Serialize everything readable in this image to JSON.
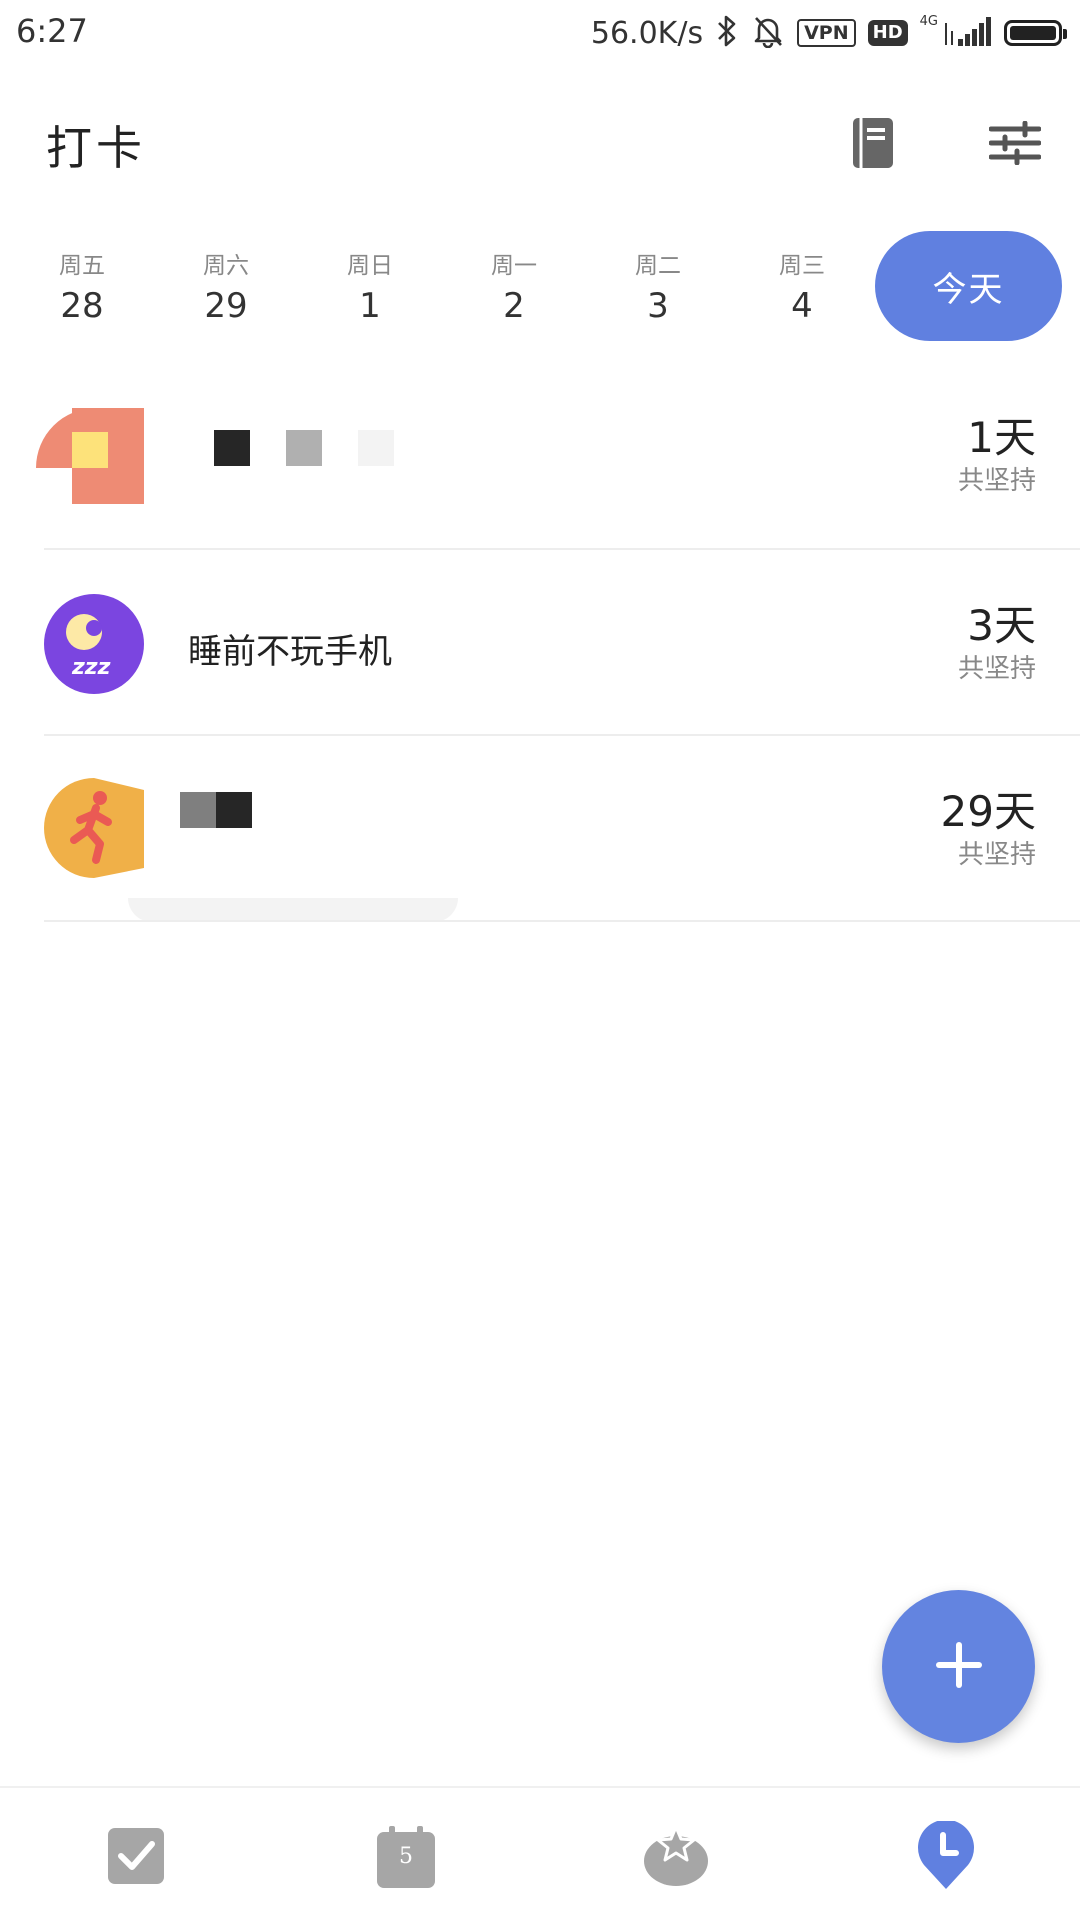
{
  "status_bar": {
    "time": "6:27",
    "net_speed": "56.0K/s",
    "vpn_label": "VPN",
    "hd_label": "HD",
    "network_label": "4G",
    "icons": [
      "bluetooth-icon",
      "bell-off-icon",
      "signal-icon",
      "battery-icon"
    ]
  },
  "header": {
    "title": "打卡",
    "actions": [
      "notebook-icon",
      "filter-sliders-icon"
    ]
  },
  "week": {
    "days": [
      {
        "name": "周五",
        "num": "28"
      },
      {
        "name": "周六",
        "num": "29"
      },
      {
        "name": "周日",
        "num": "1"
      },
      {
        "name": "周一",
        "num": "2"
      },
      {
        "name": "周二",
        "num": "3"
      },
      {
        "name": "周三",
        "num": "4"
      }
    ],
    "today_label": "今天"
  },
  "habits": [
    {
      "name": "",
      "days": "1天",
      "label": "共坚持",
      "icon": "pixelated-avatar-icon"
    },
    {
      "name": "睡前不玩手机",
      "days": "3天",
      "label": "共坚持",
      "icon": "moon-sleep-icon"
    },
    {
      "name": "",
      "days": "29天",
      "label": "共坚持",
      "icon": "runner-icon"
    }
  ],
  "fab": {
    "icon": "plus-icon"
  },
  "bottom_nav": {
    "items": [
      {
        "icon": "checkbox-icon"
      },
      {
        "icon": "calendar-icon",
        "label": "5"
      },
      {
        "icon": "pomodoro-icon"
      },
      {
        "icon": "clock-pin-icon",
        "active": true
      }
    ]
  },
  "colors": {
    "accent": "#6080e0",
    "sleep_icon": "#7b45e0",
    "runner_icon": "#f0b048",
    "avatar_orange": "#ee8b74"
  }
}
